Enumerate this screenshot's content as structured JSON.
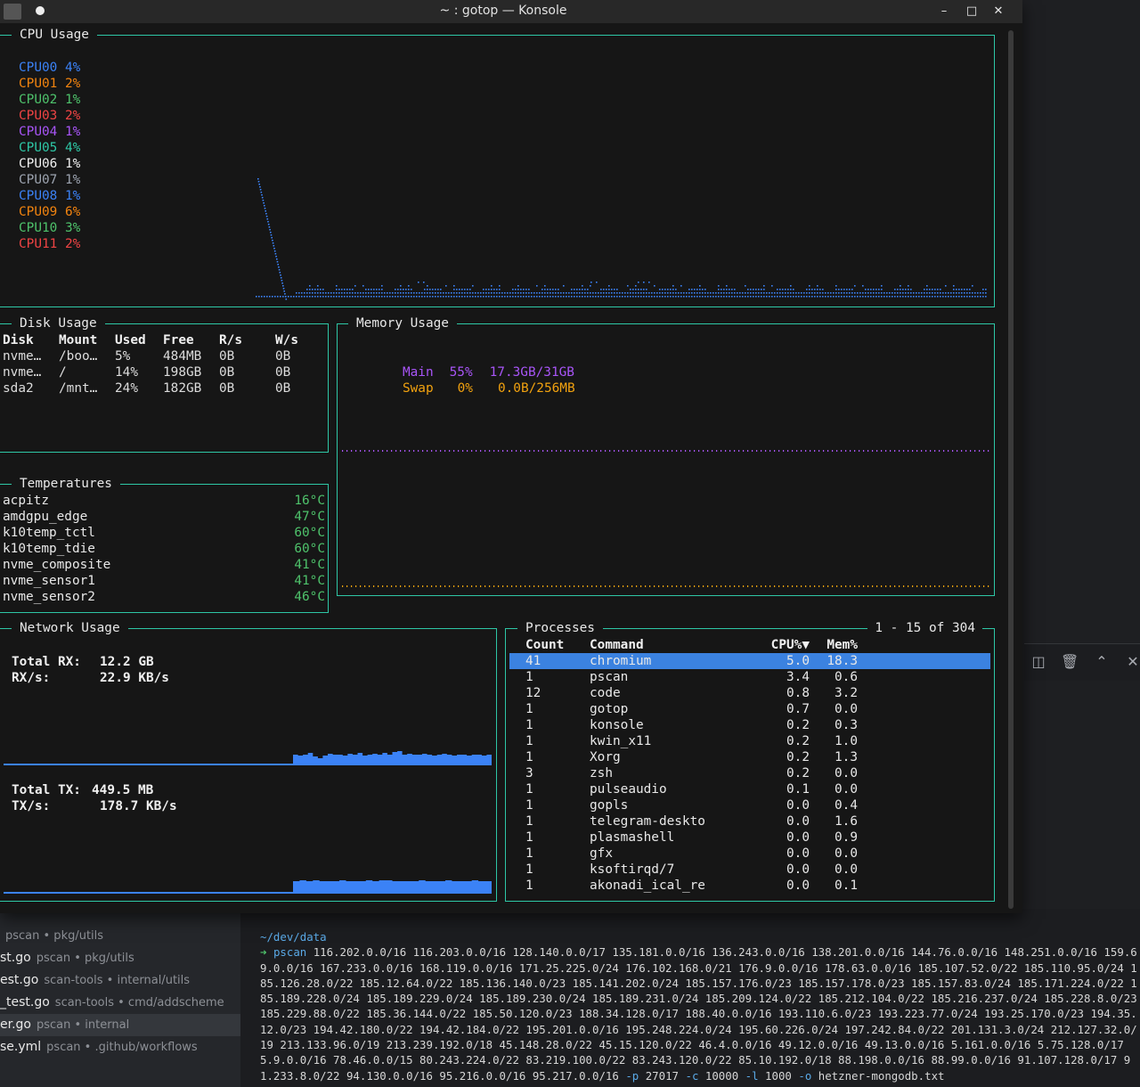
{
  "window": {
    "title": "~ : gotop — Konsole",
    "buttons": {
      "minimize": "–",
      "maximize": "□",
      "close": "✕"
    }
  },
  "cpu": {
    "title": "CPU Usage",
    "cores": [
      {
        "name": "CPU00",
        "pct": "4%",
        "color": "#3b82f6"
      },
      {
        "name": "CPU01",
        "pct": "2%",
        "color": "#f2840f"
      },
      {
        "name": "CPU02",
        "pct": "1%",
        "color": "#4ec26b"
      },
      {
        "name": "CPU03",
        "pct": "2%",
        "color": "#ef4444"
      },
      {
        "name": "CPU04",
        "pct": "1%",
        "color": "#a855f7"
      },
      {
        "name": "CPU05",
        "pct": "4%",
        "color": "#2ec7a6"
      },
      {
        "name": "CPU06",
        "pct": "1%",
        "color": "#f0f0f0"
      },
      {
        "name": "CPU07",
        "pct": "1%",
        "color": "#9ca3af"
      },
      {
        "name": "CPU08",
        "pct": "1%",
        "color": "#3b82f6"
      },
      {
        "name": "CPU09",
        "pct": "6%",
        "color": "#f2840f"
      },
      {
        "name": "CPU10",
        "pct": "3%",
        "color": "#4ec26b"
      },
      {
        "name": "CPU11",
        "pct": "2%",
        "color": "#ef4444"
      }
    ]
  },
  "disk": {
    "title": "Disk Usage",
    "headers": [
      "Disk",
      "Mount",
      "Used",
      "Free",
      "R/s",
      "W/s"
    ],
    "rows": [
      [
        "nvme…",
        "/boo…",
        "5%",
        "484MB",
        "0B",
        "0B"
      ],
      [
        "nvme…",
        "/",
        "14%",
        "198GB",
        "0B",
        "0B"
      ],
      [
        "sda2",
        "/mnt…",
        "24%",
        "182GB",
        "0B",
        "0B"
      ]
    ]
  },
  "memory": {
    "title": "Memory Usage",
    "main": {
      "label": "Main",
      "pct": "55%",
      "amount": "17.3GB/31GB",
      "color": "#a855f7"
    },
    "swap": {
      "label": "Swap",
      "pct": "0%",
      "amount": "0.0B/256MB",
      "color": "#f2a20f"
    }
  },
  "temps": {
    "title": "Temperatures",
    "rows": [
      {
        "name": "acpitz",
        "value": "16°C"
      },
      {
        "name": "amdgpu_edge",
        "value": "47°C"
      },
      {
        "name": "k10temp_tctl",
        "value": "60°C"
      },
      {
        "name": "k10temp_tdie",
        "value": "60°C"
      },
      {
        "name": "nvme_composite",
        "value": "41°C"
      },
      {
        "name": "nvme_sensor1",
        "value": "41°C"
      },
      {
        "name": "nvme_sensor2",
        "value": "46°C"
      }
    ]
  },
  "network": {
    "title": "Network Usage",
    "rx_total_label": "Total RX:",
    "rx_total": "12.2 GB",
    "rx_rate_label": "RX/s:",
    "rx_rate": "22.9 KB/s",
    "tx_total_label": "Total TX:",
    "tx_total": "449.5 MB",
    "tx_rate_label": "TX/s:",
    "tx_rate": "178.7 KB/s",
    "color": "#3b82f6"
  },
  "processes": {
    "title": "Processes",
    "range": "1 - 15 of 304",
    "headers": [
      "Count",
      "Command",
      "CPU%▼",
      "Mem%"
    ],
    "rows": [
      [
        "41",
        "chromium",
        "5.0",
        "18.3"
      ],
      [
        "1",
        "pscan",
        "3.4",
        "0.6"
      ],
      [
        "12",
        "code",
        "0.8",
        "3.2"
      ],
      [
        "1",
        "gotop",
        "0.7",
        "0.0"
      ],
      [
        "1",
        "konsole",
        "0.2",
        "0.3"
      ],
      [
        "1",
        "kwin_x11",
        "0.2",
        "1.0"
      ],
      [
        "1",
        "Xorg",
        "0.2",
        "1.3"
      ],
      [
        "3",
        "zsh",
        "0.2",
        "0.0"
      ],
      [
        "1",
        "pulseaudio",
        "0.1",
        "0.0"
      ],
      [
        "1",
        "gopls",
        "0.0",
        "0.4"
      ],
      [
        "1",
        "telegram-deskto",
        "0.0",
        "1.6"
      ],
      [
        "1",
        "plasmashell",
        "0.0",
        "0.9"
      ],
      [
        "1",
        "gfx",
        "0.0",
        "0.0"
      ],
      [
        "1",
        "ksoftirqd/7",
        "0.0",
        "0.0"
      ],
      [
        "1",
        "akonadi_ical_re",
        "0.0",
        "0.1"
      ]
    ]
  },
  "bg_sidebar": {
    "files": [
      {
        "name": "",
        "path": "pscan • pkg/utils"
      },
      {
        "name": "st.go",
        "path": "pscan • pkg/utils"
      },
      {
        "name": "est.go",
        "path": "scan-tools • internal/utils"
      },
      {
        "name": "_test.go",
        "path": "scan-tools • cmd/addscheme"
      },
      {
        "name": "er.go",
        "path": "pscan • internal"
      },
      {
        "name": "se.yml",
        "path": "pscan • .github/workflows"
      }
    ]
  },
  "bg_terminal": {
    "cwd": "~/dev/data",
    "prompt": "➜",
    "command": "pscan",
    "args": "116.202.0.0/16 116.203.0.0/16 128.140.0.0/17 135.181.0.0/16 136.243.0.0/16 138.201.0.0/16 144.76.0.0/16 148.251.0.0/16 159.69.0.0/16 167.233.0.0/16 168.119.0.0/16 171.25.225.0/24 176.102.168.0/21 176.9.0.0/16 178.63.0.0/16 185.107.52.0/22 185.110.95.0/24 185.126.28.0/22 185.12.64.0/22 185.136.140.0/23 185.141.202.0/24 185.157.176.0/23 185.157.178.0/23 185.157.83.0/24 185.171.224.0/22 185.189.228.0/24 185.189.229.0/24 185.189.230.0/24 185.189.231.0/24 185.209.124.0/22 185.212.104.0/22 185.216.237.0/24 185.228.8.0/23 185.229.88.0/22 185.36.144.0/22 185.50.120.0/23 188.34.128.0/17 188.40.0.0/16 193.110.6.0/23 193.223.77.0/24 193.25.170.0/23 194.35.12.0/23 194.42.180.0/22 194.42.184.0/22 195.201.0.0/16 195.248.224.0/24 195.60.226.0/24 197.242.84.0/22 201.131.3.0/24 212.127.32.0/19 213.133.96.0/19 213.239.192.0/18 45.148.28.0/22 45.15.120.0/22 46.4.0.0/16 49.12.0.0/16 49.13.0.0/16 5.161.0.0/16 5.75.128.0/17 5.9.0.0/16 78.46.0.0/15 80.243.224.0/22 83.219.100.0/22 83.243.120.0/22 85.10.192.0/18 88.198.0.0/16 88.99.0.0/16 91.107.128.0/17 91.233.8.0/22 94.130.0.0/16 95.216.0.0/16 95.217.0.0/16",
    "flag_p": "-p",
    "val_p": "27017",
    "flag_c": "-c",
    "val_c": "10000",
    "flag_l": "-l",
    "val_l": "1000",
    "flag_o": "-o",
    "val_o": "hetzner-mongodb.txt"
  }
}
